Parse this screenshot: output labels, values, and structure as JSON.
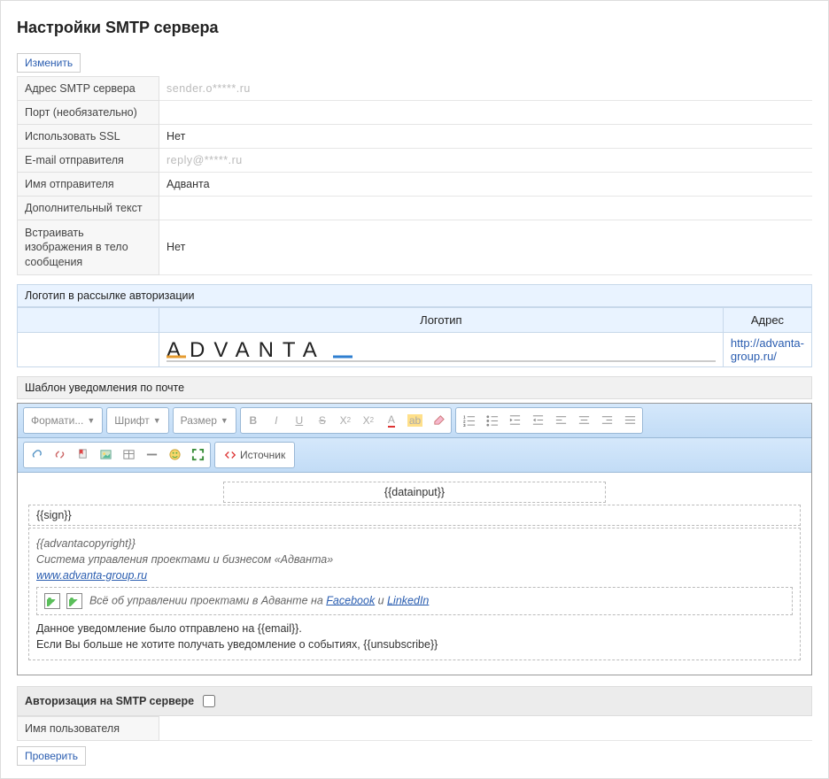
{
  "title": "Настройки SMTP сервера",
  "buttons": {
    "edit": "Изменить",
    "verify": "Проверить",
    "source": "Источник"
  },
  "props": {
    "smtp_addr_label": "Адрес SMTP сервера",
    "smtp_addr_value": "sender.o*****.ru",
    "port_label": "Порт (необязательно)",
    "port_value": "",
    "ssl_label": "Использовать SSL",
    "ssl_value": "Нет",
    "sender_email_label": "E-mail отправителя",
    "sender_email_value": "reply@*****.ru",
    "sender_name_label": "Имя отправителя",
    "sender_name_value": "Адванта",
    "extra_text_label": "Дополнительный текст",
    "extra_text_value": "",
    "embed_label": "Встраивать изображения в тело сообщения",
    "embed_value": "Нет"
  },
  "sections": {
    "logo": "Логотип в рассылке авторизации",
    "template": "Шаблон уведомления по почте",
    "auth": "Авторизация на SMTP сервере",
    "username_label": "Имя пользователя",
    "username_value": ""
  },
  "logo_table": {
    "col_logo": "Логотип",
    "col_addr": "Адрес",
    "addr_value": "http://advanta-group.ru/",
    "logo_text": "ADVANTA"
  },
  "toolbar": {
    "format": "Формати...",
    "font": "Шрифт",
    "size": "Размер"
  },
  "editor": {
    "datainput": "{{datainput}}",
    "sign": "{{sign}}",
    "copyright": "{{advantacopyright}}",
    "system_line": "Система управления проектами и бизнесом «Адванта»",
    "site": "www.advanta-group.ru",
    "social_pre": "Всё об управлении проектами в Адванте на ",
    "fb": "Facebook",
    "and": " и ",
    "li": "LinkedIn",
    "sent_line": "Данное уведомление было отправлено на {{email}}.",
    "unsub_line": "Если Вы больше не хотите получать уведомление о событиях, {{unsubscribe}}"
  }
}
